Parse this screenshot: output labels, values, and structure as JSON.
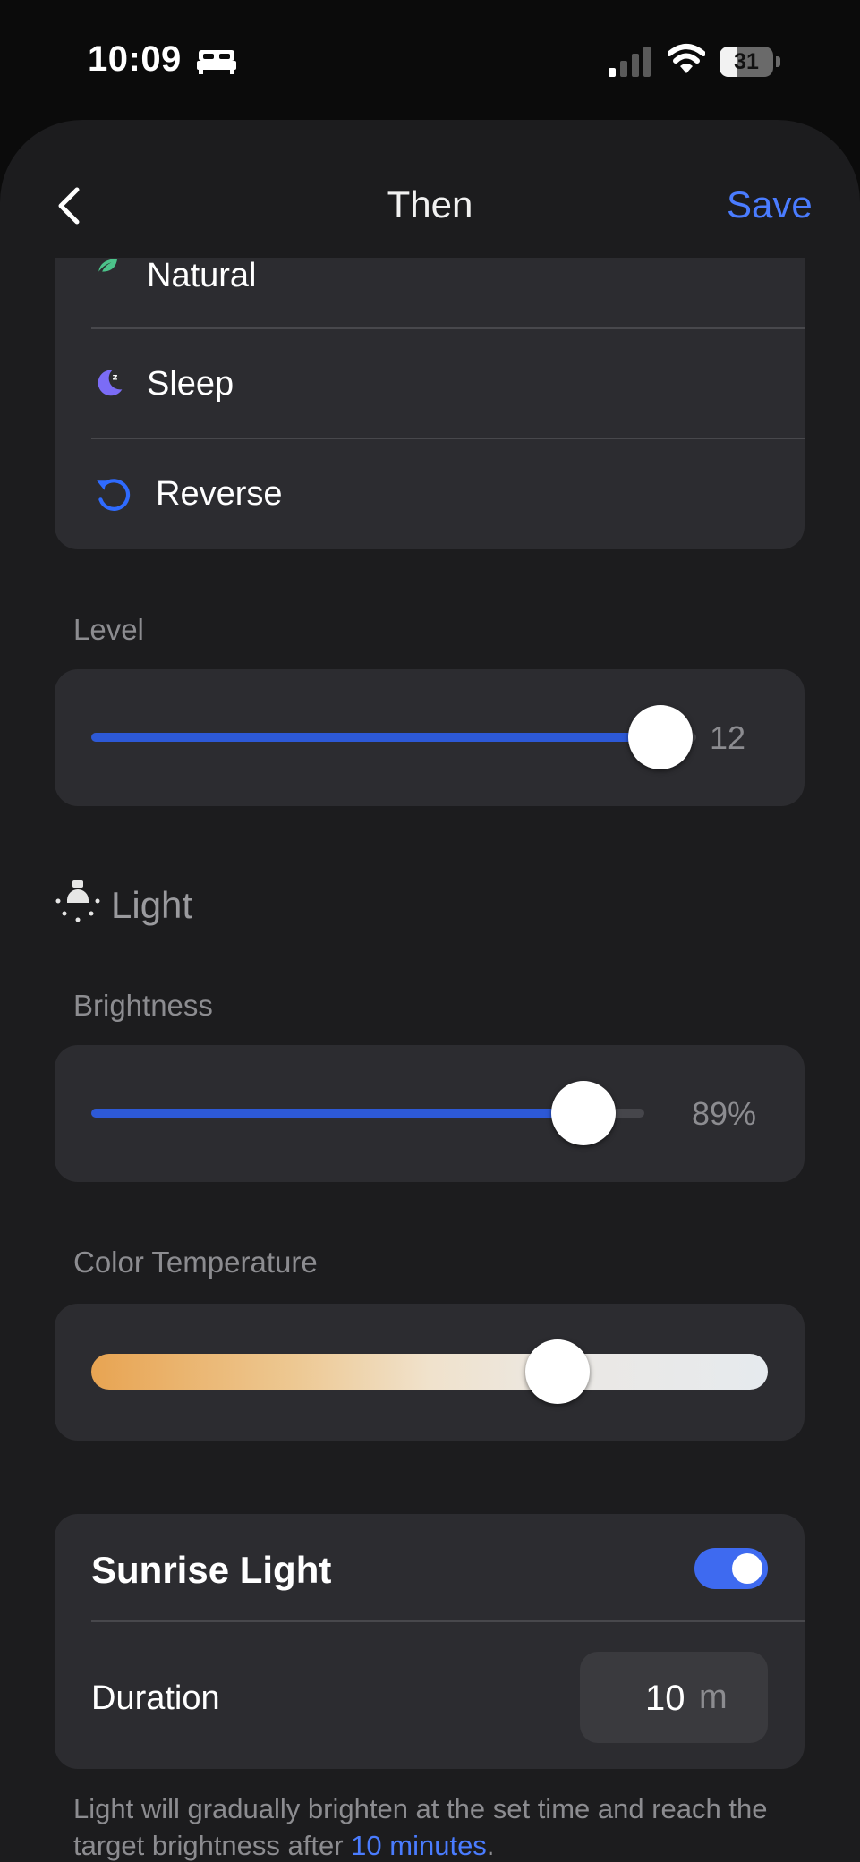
{
  "status_bar": {
    "time": "10:09",
    "battery": "31",
    "battery_level": 0.31
  },
  "nav": {
    "title": "Then",
    "save_label": "Save"
  },
  "modes": [
    {
      "label": "Natural",
      "icon": "leaf-icon",
      "color": "#4cc38a"
    },
    {
      "label": "Sleep",
      "icon": "moon-sleep-icon",
      "color": "#7b6cf6"
    },
    {
      "label": "Reverse",
      "icon": "reverse-rotate-icon",
      "color": "#2f6bff"
    }
  ],
  "level": {
    "label": "Level",
    "value": "12",
    "fraction": 1.0
  },
  "light": {
    "title": "Light",
    "brightness": {
      "label": "Brightness",
      "value": "89%",
      "fraction": 0.89
    },
    "color_temperature": {
      "label": "Color Temperature",
      "fraction": 0.7
    }
  },
  "sunrise": {
    "title": "Sunrise Light",
    "enabled": true,
    "duration_label": "Duration",
    "duration_value": "10",
    "duration_unit": "m"
  },
  "footnote": {
    "text_before": "Light will gradually brighten at the set time and reach the target brightness after ",
    "link": "10 minutes",
    "text_after": "."
  },
  "colors": {
    "accent": "#4a7cff",
    "slider_fill": "#2d59d6",
    "toggle_on": "#3e6af0"
  }
}
